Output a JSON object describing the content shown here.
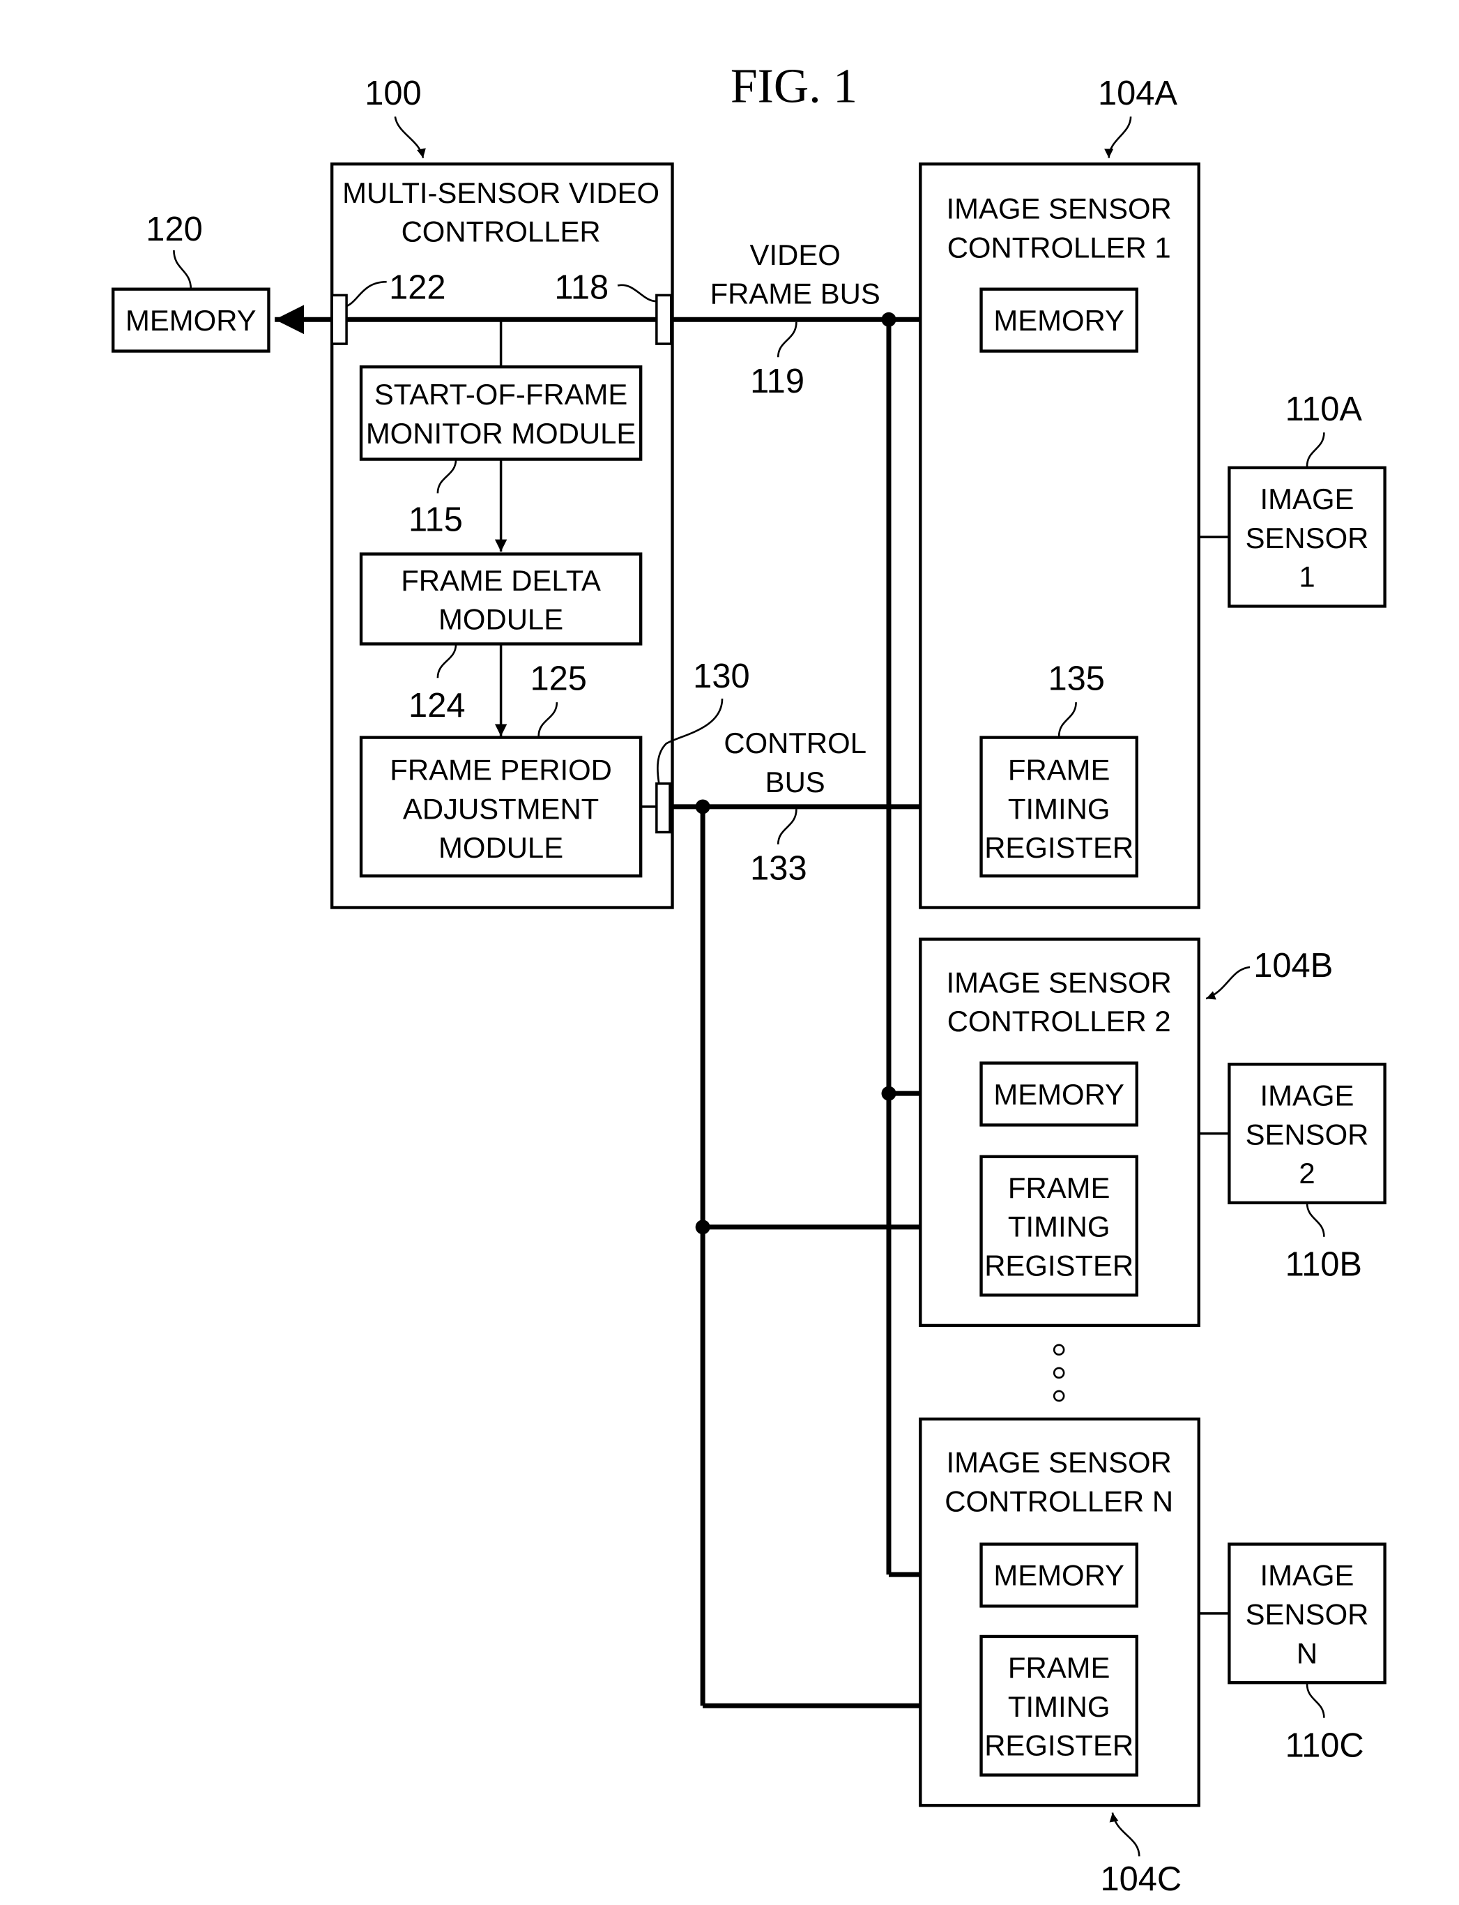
{
  "figure": {
    "title": "FIG. 1",
    "refs": {
      "controller": "100",
      "memory_ext": "120",
      "port_122": "122",
      "port_118": "118",
      "video_bus": "119",
      "sof_module": "115",
      "delta_module": "124",
      "period_module": "125",
      "port_130": "130",
      "control_bus": "133",
      "isc1": "104A",
      "isc2": "104B",
      "iscn": "104C",
      "sensor1": "110A",
      "sensor2": "110B",
      "sensorn": "110C",
      "ftr": "135"
    },
    "controller": {
      "title_lines": [
        "MULTI-SENSOR VIDEO",
        "CONTROLLER"
      ],
      "sof_lines": [
        "START-OF-FRAME",
        "MONITOR MODULE"
      ],
      "delta_lines": [
        "FRAME DELTA",
        "MODULE"
      ],
      "period_lines": [
        "FRAME PERIOD",
        "ADJUSTMENT",
        "MODULE"
      ]
    },
    "external_memory": "MEMORY",
    "video_bus_lines": [
      "VIDEO",
      "FRAME BUS"
    ],
    "control_bus_lines": [
      "CONTROL",
      "BUS"
    ],
    "sensor_controllers": [
      {
        "title_lines": [
          "IMAGE SENSOR",
          "CONTROLLER 1"
        ],
        "memory": "MEMORY",
        "register_lines": [
          "FRAME",
          "TIMING",
          "REGISTER"
        ]
      },
      {
        "title_lines": [
          "IMAGE SENSOR",
          "CONTROLLER 2"
        ],
        "memory": "MEMORY",
        "register_lines": [
          "FRAME",
          "TIMING",
          "REGISTER"
        ]
      },
      {
        "title_lines": [
          "IMAGE SENSOR",
          "CONTROLLER N"
        ],
        "memory": "MEMORY",
        "register_lines": [
          "FRAME",
          "TIMING",
          "REGISTER"
        ]
      }
    ],
    "image_sensors": [
      {
        "lines": [
          "IMAGE",
          "SENSOR",
          "1"
        ]
      },
      {
        "lines": [
          "IMAGE",
          "SENSOR",
          "2"
        ]
      },
      {
        "lines": [
          "IMAGE",
          "SENSOR",
          "N"
        ]
      }
    ]
  }
}
